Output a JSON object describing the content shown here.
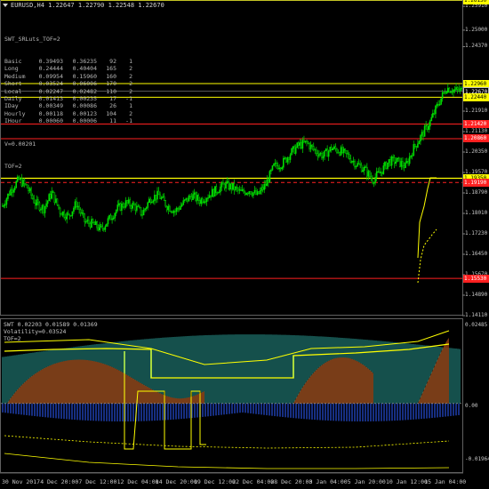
{
  "header": {
    "title": "EURUSD,H4  1.22647 1.22790 1.22548 1.22670"
  },
  "info_panel": {
    "label": "SWT_SRLuts_TOF=2",
    "rows": [
      [
        "Basic",
        "0.39493",
        "0.36235",
        "92",
        "1"
      ],
      [
        "Long",
        "0.24444",
        "0.40404",
        "165",
        "2"
      ],
      [
        "Medium",
        "0.09954",
        "0.15960",
        "160",
        "2"
      ],
      [
        "Short",
        "0.03524",
        "0.06006",
        "170",
        "2"
      ],
      [
        "Local",
        "0.02247",
        "0.02482",
        "110",
        "2"
      ],
      [
        "Daily",
        "0.01413",
        "0.00235",
        "17",
        "-1"
      ],
      [
        "IDay",
        "0.00349",
        "0.00086",
        "26",
        "1"
      ],
      [
        "Hourly",
        "0.00118",
        "0.00123",
        "104",
        "2"
      ],
      [
        "IHour",
        "0.00060",
        "0.00006",
        "11",
        "-1"
      ]
    ],
    "v_line": "V=0.00201",
    "tof_line": "TOF=2"
  },
  "indicator": {
    "header": "SWT 0.02203 0.01589 0.01369",
    "volatility": "Volatility=0.03524",
    "tof": "TOF=2",
    "ticks": [
      "0.02485",
      "0.00",
      "-0.01964"
    ]
  },
  "price_axis": {
    "ticks": [
      "1.25910",
      "1.25000",
      "1.24370",
      "1.22670",
      "1.21910",
      "1.21130",
      "1.20350",
      "1.19570",
      "1.18790",
      "1.18010",
      "1.17230",
      "1.16450",
      "1.15670",
      "1.14890",
      "1.14110"
    ],
    "level_labels": [
      {
        "text": "1.26150",
        "color": "#ffff00",
        "text_color": "#000000"
      },
      {
        "text": "1.22960",
        "color": "#ffff00",
        "text_color": "#000000"
      },
      {
        "text": "1.22670",
        "color": "#000000",
        "text_color": "#ffffff"
      },
      {
        "text": "1.22440",
        "color": "#ffff00",
        "text_color": "#000000"
      },
      {
        "text": "1.21420",
        "color": "#ff2020",
        "text_color": "#ffffff"
      },
      {
        "text": "1.20860",
        "color": "#ff2020",
        "text_color": "#ffffff"
      },
      {
        "text": "1.19350",
        "color": "#ffff00",
        "text_color": "#000000"
      },
      {
        "text": "1.19190",
        "color": "#ff2020",
        "text_color": "#ffffff"
      },
      {
        "text": "1.15530",
        "color": "#ff2020",
        "text_color": "#ffffff"
      }
    ]
  },
  "time_axis": {
    "labels": [
      "30 Nov 2017",
      "4 Dec 20:00",
      "7 Dec 12:00",
      "12 Dec 04:00",
      "14 Dec 20:00",
      "19 Dec 12:00",
      "22 Dec 04:00",
      "28 Dec 20:00",
      "3 Jan 04:00",
      "5 Jan 20:00",
      "10 Jan 12:00",
      "15 Jan 04:00"
    ]
  },
  "colors": {
    "bull": "#00e000",
    "bear": "#00e000",
    "yellow": "#ffff00",
    "red": "#ff2020",
    "teal": "#2aa198",
    "blue": "#1f3fae",
    "brown": "#8b3a0f"
  },
  "chart_data": {
    "type": "candlestick",
    "symbol": "EURUSD",
    "timeframe": "H4",
    "last": {
      "open": 1.22647,
      "high": 1.2279,
      "low": 1.22548,
      "close": 1.2267
    },
    "ylim": [
      1.1411,
      1.2615
    ],
    "levels": [
      1.2615,
      1.2296,
      1.2244,
      1.2142,
      1.2086,
      1.1935,
      1.1919,
      1.1553
    ],
    "trend_close": [
      1.183,
      1.189,
      1.193,
      1.19,
      1.184,
      1.182,
      1.188,
      1.181,
      1.179,
      1.184,
      1.177,
      1.176,
      1.174,
      1.178,
      1.182,
      1.184,
      1.183,
      1.18,
      1.186,
      1.187,
      1.183,
      1.181,
      1.184,
      1.187,
      1.185,
      1.187,
      1.189,
      1.191,
      1.19,
      1.188,
      1.189,
      1.187,
      1.191,
      1.198,
      1.199,
      1.203,
      1.206,
      1.207,
      1.204,
      1.202,
      1.205,
      1.204,
      1.202,
      1.199,
      1.197,
      1.193,
      1.196,
      1.2,
      1.2,
      1.198,
      1.205,
      1.21,
      1.215,
      1.222,
      1.228,
      1.227
    ]
  }
}
